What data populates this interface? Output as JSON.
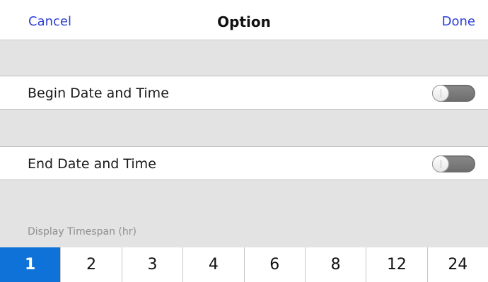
{
  "header": {
    "cancel_label": "Cancel",
    "title": "Option",
    "done_label": "Done"
  },
  "options": [
    {
      "label": "Begin Date and Time",
      "enabled": false
    },
    {
      "label": "End Date and Time",
      "enabled": false
    }
  ],
  "timespan": {
    "label": "Display Timespan (hr)",
    "selected": "1",
    "values": [
      "1",
      "2",
      "3",
      "4",
      "6",
      "8",
      "12",
      "24"
    ]
  },
  "colors": {
    "accent": "#2d3fd6",
    "selected_segment": "#0f72d8",
    "group_background": "#e3e3e3"
  }
}
